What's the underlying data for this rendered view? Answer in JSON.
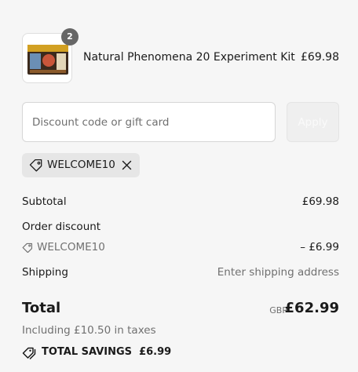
{
  "product": {
    "name": "Natural Phenomena 20 Experiment Kit",
    "price": "£69.98",
    "quantity": "2",
    "image_icon": "product-box-image"
  },
  "discount": {
    "placeholder": "Discount code or gift card",
    "value": "",
    "apply_label": "Apply"
  },
  "applied_code": {
    "code": "WELCOME10",
    "tag_icon": "tag-icon",
    "remove_icon": "close-icon"
  },
  "summary": {
    "subtotal_label": "Subtotal",
    "subtotal_value": "£69.98",
    "order_discount_label": "Order discount",
    "discount_code": "WELCOME10",
    "discount_value": "– £6.99",
    "shipping_label": "Shipping",
    "shipping_value": "Enter shipping address"
  },
  "total": {
    "label": "Total",
    "currency": "GBP",
    "value": "£62.99",
    "taxes": "Including £10.50 in taxes",
    "savings_label": "TOTAL SAVINGS",
    "savings_value": "£6.99"
  },
  "colors": {
    "background": "#f6f6f6",
    "text": "#1a1a1a",
    "muted": "#707070",
    "chip": "#e6e6e6",
    "badge": "#666666"
  }
}
